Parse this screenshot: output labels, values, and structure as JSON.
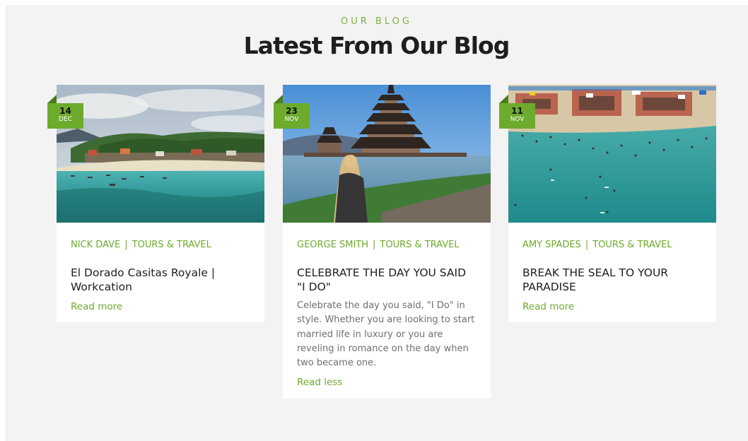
{
  "section": {
    "eyebrow": "OUR BLOG",
    "title": "Latest From Our Blog"
  },
  "colors": {
    "accent": "#6cab2c",
    "background": "#f3f3f3",
    "card": "#ffffff"
  },
  "posts": [
    {
      "date_day": "14",
      "date_month": "DEC",
      "author": "NICK DAVE",
      "category": "TOURS & TRAVEL",
      "title": "El Dorado Casitas Royale | Workcation",
      "link_label": "Read more"
    },
    {
      "date_day": "23",
      "date_month": "NOV",
      "author": "GEORGE SMITH",
      "category": "TOURS & TRAVEL",
      "title": "CELEBRATE THE DAY YOU SAID \"I DO\"",
      "excerpt": "Celebrate the day you said, \"I Do\" in style. Whether you are looking to start married life in luxury or you are reveling in romance on the day when two became one.",
      "link_label": "Read less"
    },
    {
      "date_day": "11",
      "date_month": "NOV",
      "author": "AMY SPADES",
      "category": "TOURS & TRAVEL",
      "title": "BREAK THE SEAL TO YOUR PARADISE",
      "link_label": "Read more"
    }
  ]
}
